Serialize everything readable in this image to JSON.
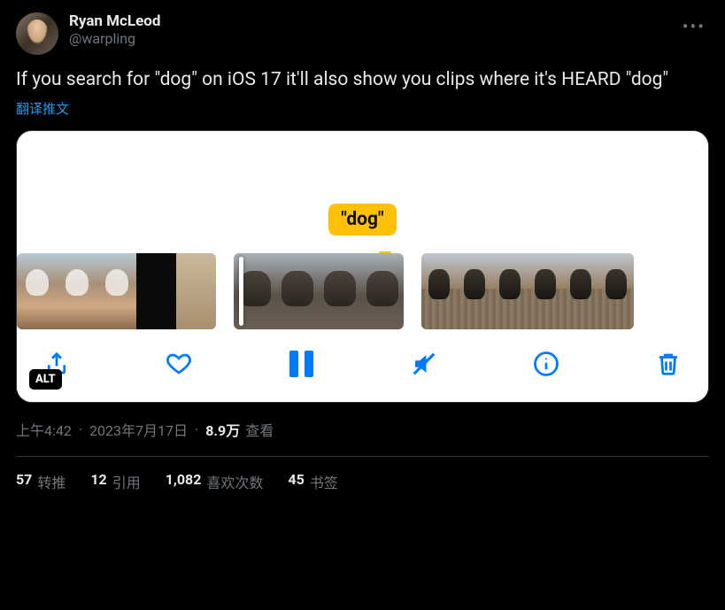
{
  "author": {
    "display_name": "Ryan McLeod",
    "handle": "@warpling"
  },
  "tweet_text": "If you search for \"dog\" on iOS 17 it'll also show you clips where it's HEARD \"dog\"",
  "translate_label": "翻译推文",
  "media": {
    "caption_text": "\"dog\"",
    "alt_badge": "ALT"
  },
  "timestamp": {
    "time": "上午4:42",
    "date": "2023年7月17日",
    "views_num": "8.9万",
    "views_label": "查看"
  },
  "stats": {
    "retweets_num": "57",
    "retweets_label": "转推",
    "quotes_num": "12",
    "quotes_label": "引用",
    "likes_num": "1,082",
    "likes_label": "喜欢次数",
    "bookmarks_num": "45",
    "bookmarks_label": "书签"
  }
}
